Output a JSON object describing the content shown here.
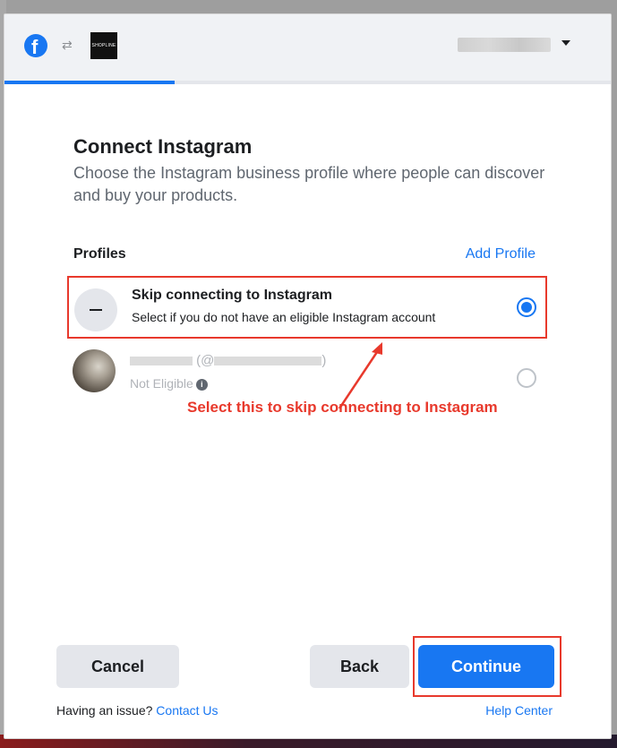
{
  "header": {
    "logo_icon": "facebook-icon",
    "sync_icon": "sync-icon",
    "partner_logo_text": "SHOPLINE",
    "progress_fraction": 0.28
  },
  "dialog": {
    "title": "Connect Instagram",
    "subtitle": "Choose the Instagram business profile where people can discover and buy your products.",
    "profiles_label": "Profiles",
    "add_profile_label": "Add Profile"
  },
  "profiles": [
    {
      "title": "Skip connecting to Instagram",
      "subtitle": "Select if you do not have an eligible Instagram account",
      "selected": true
    },
    {
      "name_partial": "(@",
      "name_end": ")",
      "status": "Not Eligible",
      "selected": false
    }
  ],
  "annotation": {
    "text": "Select this to skip connecting to Instagram",
    "color": "#e8392c"
  },
  "footer": {
    "cancel_label": "Cancel",
    "back_label": "Back",
    "continue_label": "Continue",
    "issue_text": "Having an issue?",
    "contact_label": "Contact Us",
    "help_label": "Help Center"
  },
  "colors": {
    "accent": "#1877f2",
    "highlight": "#e8392c"
  }
}
